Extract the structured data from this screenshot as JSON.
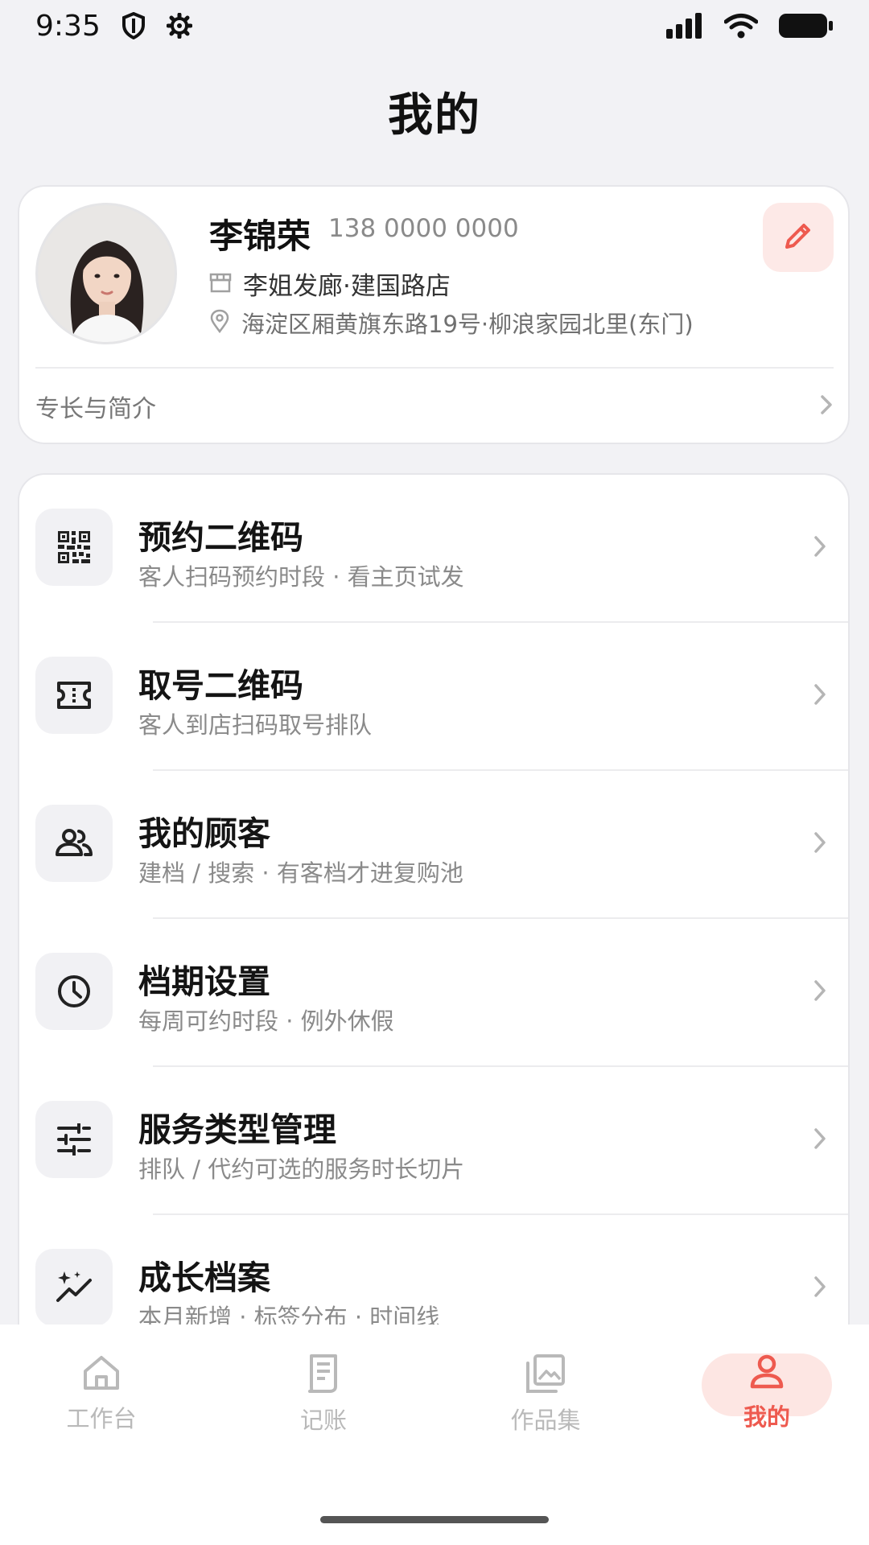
{
  "status_bar": {
    "time": "9:35",
    "icons": [
      "shield-icon",
      "gear-icon",
      "signal-icon",
      "wifi-icon",
      "battery-icon"
    ]
  },
  "page": {
    "title": "我的"
  },
  "profile": {
    "name": "李锦荣",
    "phone": "138 0000 0000",
    "shop_name": "李姐发廊·建国路店",
    "address": "海淀区厢黄旗东路19号·柳浪家园北里(东门)",
    "intro_label": "专长与简介",
    "edit_icon": "pencil-icon",
    "accent_color": "#ee5a4f"
  },
  "menu": {
    "items": [
      {
        "title": "预约二维码",
        "subtitle": "客人扫码预约时段 · 看主页试发",
        "icon": "qr-code-icon"
      },
      {
        "title": "取号二维码",
        "subtitle": "客人到店扫码取号排队",
        "icon": "ticket-icon"
      },
      {
        "title": "我的顾客",
        "subtitle": "建档 / 搜索 · 有客档才进复购池",
        "icon": "people-icon"
      },
      {
        "title": "档期设置",
        "subtitle": "每周可约时段 · 例外休假",
        "icon": "clock-icon"
      },
      {
        "title": "服务类型管理",
        "subtitle": "排队 / 代约可选的服务时长切片",
        "icon": "sliders-icon"
      },
      {
        "title": "成长档案",
        "subtitle": "本月新增 · 标签分布 · 时间线",
        "icon": "sparkle-trend-icon"
      }
    ]
  },
  "bottom_nav": {
    "items": [
      {
        "label": "工作台",
        "icon": "home-icon",
        "active": false
      },
      {
        "label": "记账",
        "icon": "receipt-icon",
        "active": false
      },
      {
        "label": "作品集",
        "icon": "gallery-icon",
        "active": false
      },
      {
        "label": "我的",
        "icon": "person-icon",
        "active": true
      }
    ],
    "active_color": "#ee5a4f",
    "inactive_color": "#b9b9b9"
  }
}
